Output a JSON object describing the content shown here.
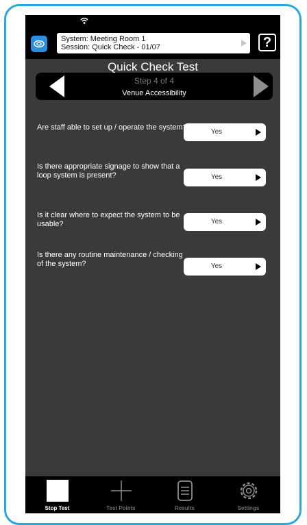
{
  "header": {
    "system_label": "System: Meeting Room 1",
    "session_label": "Session: Quick Check - 01/07",
    "help_label": "?"
  },
  "test": {
    "title": "Quick Check Test",
    "step": "Step 4 of 4",
    "section": "Venue Accessibility"
  },
  "questions": [
    {
      "text": "Are staff able to set up / operate the system?",
      "answer": "Yes"
    },
    {
      "text": "Is there appropriate signage to show that a loop system is present?",
      "answer": "Yes"
    },
    {
      "text": "Is it clear where to expect the system to be usable?",
      "answer": "Yes"
    },
    {
      "text": "Is there any routine maintenance / checking of the system?",
      "answer": "Yes"
    }
  ],
  "tabs": [
    {
      "label": "Stop Test",
      "icon": "stop-icon",
      "active": true
    },
    {
      "label": "Test Points",
      "icon": "crosshair-icon",
      "active": false
    },
    {
      "label": "Results",
      "icon": "list-icon",
      "active": false
    },
    {
      "label": "Settings",
      "icon": "gear-icon",
      "active": false
    }
  ],
  "colors": {
    "frame": "#29a8df",
    "content_bg": "#3a3a3c",
    "logo": "#2a8ee2"
  }
}
